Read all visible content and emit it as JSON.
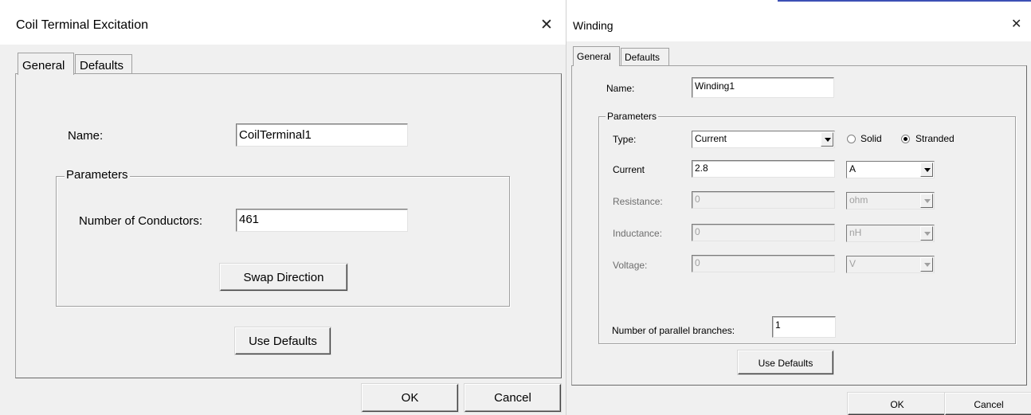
{
  "coil": {
    "title": "Coil Terminal Excitation",
    "close_glyph": "✕",
    "tabs": [
      "General",
      "Defaults"
    ],
    "name_label": "Name:",
    "name_value": "CoilTerminal1",
    "parameters_label": "Parameters",
    "conductors_label": "Number of Conductors:",
    "conductors_value": "461",
    "swap_label": "Swap Direction",
    "use_defaults_label": "Use Defaults",
    "ok_label": "OK",
    "cancel_label": "Cancel"
  },
  "winding": {
    "title": "Winding",
    "close_glyph": "✕",
    "accent_color": "#3c4fb5",
    "tabs": [
      "General",
      "Defaults"
    ],
    "name_label": "Name:",
    "name_value": "Winding1",
    "parameters_label": "Parameters",
    "type_label": "Type:",
    "type_value": "Current",
    "solid_label": "Solid",
    "stranded_label": "Stranded",
    "solid_selected": false,
    "stranded_selected": true,
    "current_label": "Current",
    "current_value": "2.8",
    "current_unit": "A",
    "resistance_label": "Resistance:",
    "resistance_value": "0",
    "resistance_unit": "ohm",
    "inductance_label": "Inductance:",
    "inductance_value": "0",
    "inductance_unit": "nH",
    "voltage_label": "Voltage:",
    "voltage_value": "0",
    "voltage_unit": "V",
    "branches_label": "Number of parallel branches:",
    "branches_value": "1",
    "use_defaults_label": "Use Defaults",
    "ok_label": "OK",
    "cancel_label": "Cancel"
  }
}
